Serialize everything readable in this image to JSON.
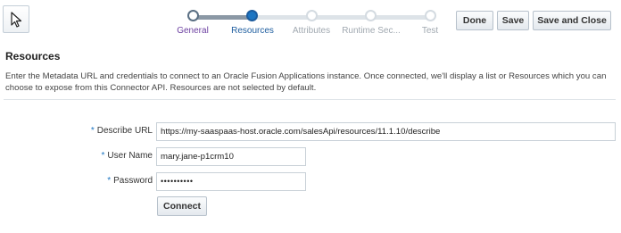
{
  "train": {
    "steps": [
      {
        "label": "General",
        "state": "visited"
      },
      {
        "label": "Resources",
        "state": "current"
      },
      {
        "label": "Attributes",
        "state": "disabled"
      },
      {
        "label": "Runtime Sec...",
        "state": "disabled"
      },
      {
        "label": "Test",
        "state": "disabled"
      }
    ]
  },
  "toolbar": {
    "done_label": "Done",
    "save_label": "Save",
    "save_close_label": "Save and Close"
  },
  "section": {
    "title": "Resources",
    "description": "Enter the Metadata URL and credentials to connect to an Oracle Fusion Applications instance. Once connected, we'll display a list or Resources which you can choose to expose from this Connector API. Resources are not selected by default."
  },
  "form": {
    "required_marker": "*",
    "describe_url_label": "Describe URL",
    "describe_url_value": "https://my-saaspaas-host.oracle.com/salesApi/resources/11.1.10/describe",
    "username_label": "User Name",
    "username_value": "mary.jane-p1crm10",
    "password_label": "Password",
    "password_value": "••••••••••",
    "connect_label": "Connect"
  },
  "colors": {
    "accent": "#1c75c2",
    "visited_link": "#6b3fa0",
    "disabled_text": "#a0a8b0"
  }
}
